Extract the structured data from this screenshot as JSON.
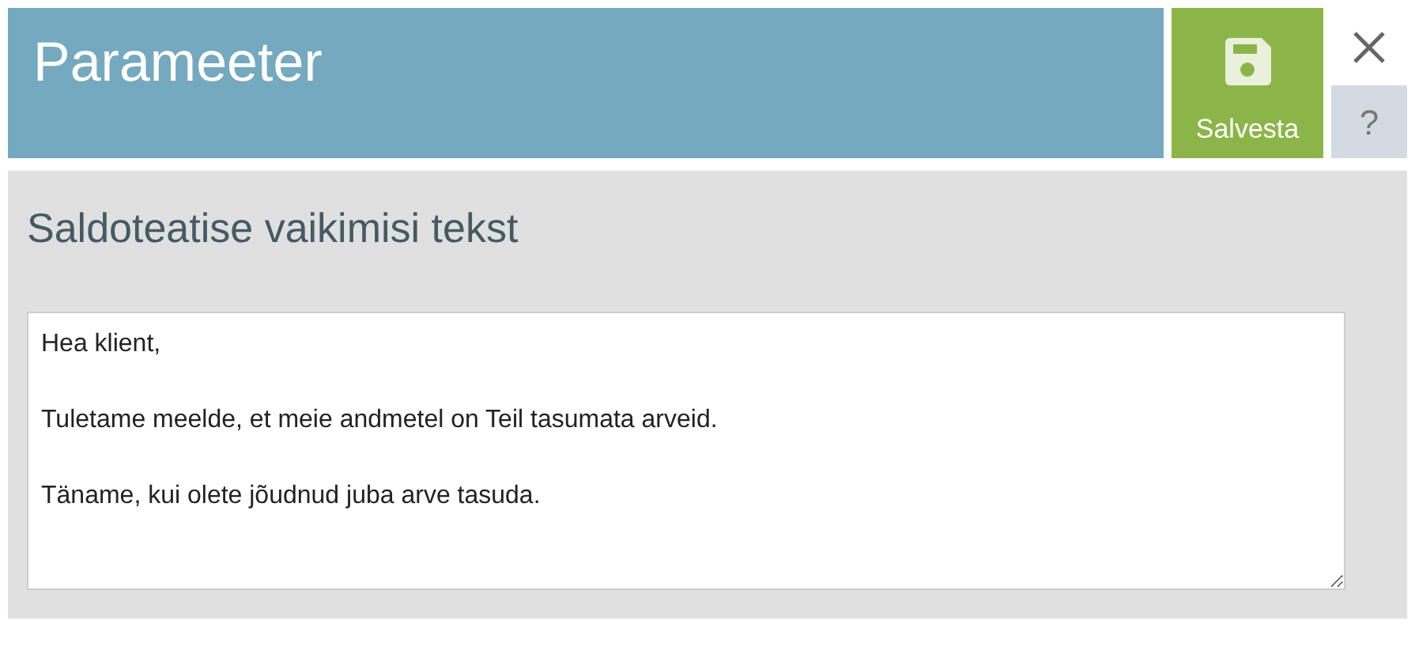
{
  "header": {
    "title": "Parameeter"
  },
  "save_button": {
    "label": "Salvesta"
  },
  "help_button": {
    "label": "?"
  },
  "panel": {
    "title": "Saldoteatise vaikimisi tekst",
    "text_field": {
      "value": "Hea klient,\n\nTuletame meelde, et meie andmetel on Teil tasumata arveid.\n\nTäname, kui olete jõudnud juba arve tasuda."
    }
  }
}
